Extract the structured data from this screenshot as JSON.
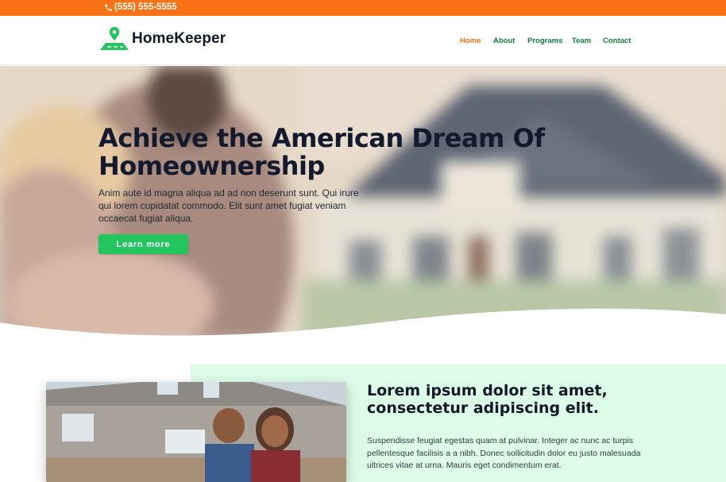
{
  "topbar": {
    "phone": "(555) 555-5555",
    "phone_icon": "phone-icon"
  },
  "header": {
    "brand": "HomeKeeper",
    "logo_icon": "house-location-pin-icon",
    "nav": [
      {
        "label": "Home",
        "active": true
      },
      {
        "label": "About",
        "active": false
      },
      {
        "label": "Programs",
        "active": false
      },
      {
        "label": "Team",
        "active": false
      },
      {
        "label": "Contact",
        "active": false
      }
    ]
  },
  "hero": {
    "title_line1": "Achieve the American Dream Of",
    "title_line2": "Homeownership",
    "text": "Anim aute id magna aliqua ad ad non deserunt sunt. Qui irure qui lorem cupidatat commodo. Elit sunt amet fugiat veniam occaecat fugiat aliqua.",
    "button_label": "Learn more"
  },
  "about": {
    "title": "Lorem ipsum dolor sit amet, consectetur adipiscing elit.",
    "text": "Suspendisse feugiat egestas quam at pulvinar. Integer ac nunc ac turpis pellentesque facilisis a a nibh. Donec sollicitudin dolor eu justo malesuada ultrices vitae at urna. Mauris eget condimentum erat."
  },
  "colors": {
    "accent_orange": "#f97316",
    "accent_green": "#22c55e",
    "nav_green": "#15803d",
    "panel_green": "#dcfce7",
    "heading_dark": "#131a2e"
  }
}
